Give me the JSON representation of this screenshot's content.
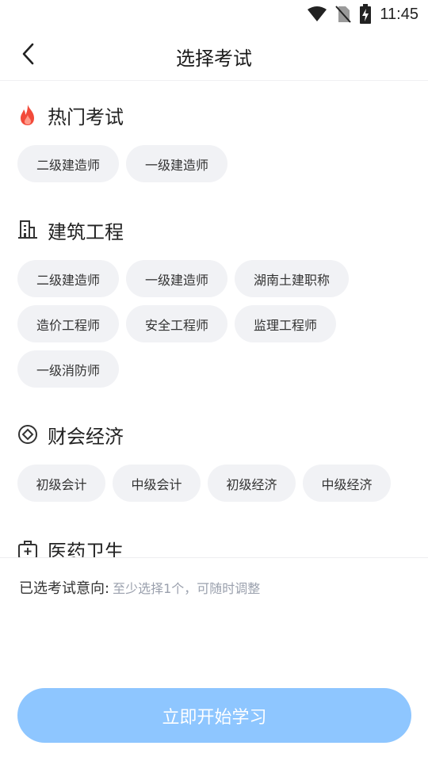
{
  "status_bar": {
    "time": "11:45"
  },
  "header": {
    "title": "选择考试"
  },
  "sections": [
    {
      "title": "热门考试",
      "icon": "flame-icon",
      "chips": [
        "二级建造师",
        "一级建造师"
      ]
    },
    {
      "title": "建筑工程",
      "icon": "building-icon",
      "chips": [
        "二级建造师",
        "一级建造师",
        "湖南土建职称",
        "造价工程师",
        "安全工程师",
        "监理工程师",
        "一级消防师"
      ]
    },
    {
      "title": "财会经济",
      "icon": "coin-icon",
      "chips": [
        "初级会计",
        "中级会计",
        "初级经济",
        "中级经济"
      ]
    },
    {
      "title": "医药卫生",
      "icon": "medical-kit-icon",
      "chips": []
    }
  ],
  "footer": {
    "selected_label": "已选考试意向:",
    "selected_hint": "至少选择1个，可随时调整",
    "start_button": "立即开始学习"
  },
  "colors": {
    "accent_button": "#8ec6ff",
    "chip_bg": "#f1f2f5",
    "flame": "#f24a3a",
    "hint": "#9aa0ad"
  }
}
